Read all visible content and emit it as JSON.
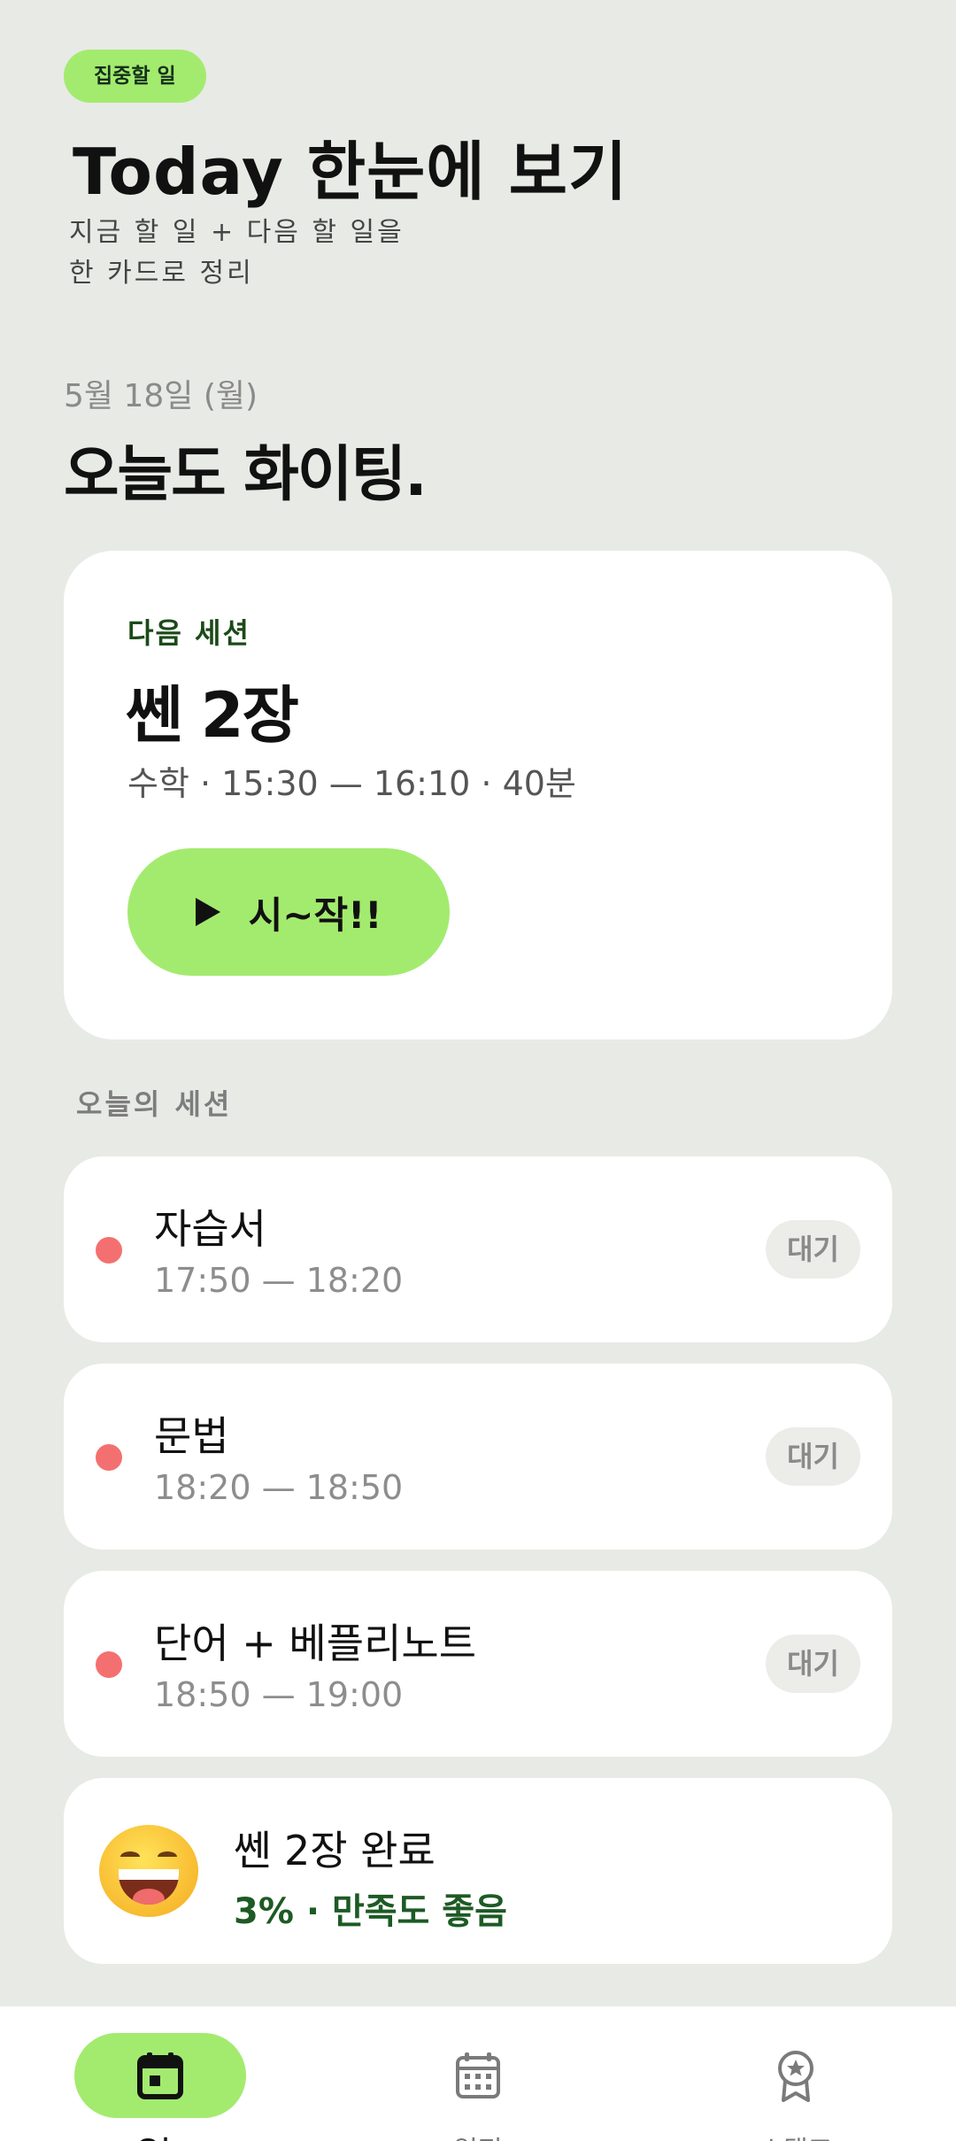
{
  "promo": {
    "tag": "집중할 일",
    "title": "Today 한눈에 보기",
    "subtitle_line1": "지금 할 일 + 다음 할 일을",
    "subtitle_line2": "한 카드로 정리"
  },
  "header": {
    "date": "5월 18일 (월)",
    "greeting": "오늘도 화이팅."
  },
  "next_session": {
    "label": "다음 세션",
    "title": "쎈 2장",
    "meta": "수학 · 15:30 — 16:10 · 40분",
    "start_label": "시~작!!"
  },
  "today": {
    "label": "오늘의 세션",
    "sessions": [
      {
        "name": "자습서",
        "time": "17:50 — 18:20",
        "status": "대기"
      },
      {
        "name": "문법",
        "time": "18:20 — 18:50",
        "status": "대기"
      },
      {
        "name": "단어 + 베플리노트",
        "time": "18:50 — 19:00",
        "status": "대기"
      }
    ]
  },
  "completed": {
    "title": "쎈 2장 완료",
    "summary": "3% · 만족도 좋음"
  },
  "nav": {
    "items": [
      {
        "label": "오늘",
        "icon": "calendar-today-icon"
      },
      {
        "label": "일정",
        "icon": "calendar-grid-icon"
      },
      {
        "label": "스탬프",
        "icon": "award-badge-icon"
      }
    ]
  },
  "colors": {
    "accent": "#a3eb6f",
    "status_dot": "#f47070",
    "background": "#e8eae5",
    "summary_text": "#1d5a24"
  }
}
